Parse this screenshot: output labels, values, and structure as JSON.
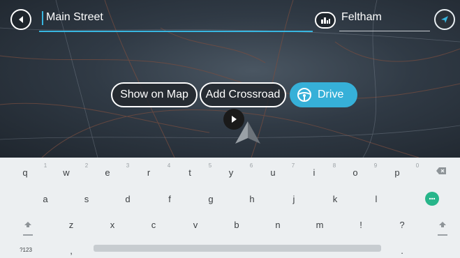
{
  "search": {
    "query": "Main Street"
  },
  "location": {
    "label": "Feltham"
  },
  "actions": {
    "show_on_map": "Show on Map",
    "add_crossroad": "Add Crossroad",
    "drive": "Drive"
  },
  "keyboard": {
    "row1": [
      "q",
      "w",
      "e",
      "r",
      "t",
      "y",
      "u",
      "i",
      "o",
      "p"
    ],
    "row1_hints": [
      "1",
      "2",
      "3",
      "4",
      "5",
      "6",
      "7",
      "8",
      "9",
      "0"
    ],
    "row2": [
      "a",
      "s",
      "d",
      "f",
      "g",
      "h",
      "j",
      "k",
      "l"
    ],
    "row3": [
      "z",
      "x",
      "c",
      "v",
      "b",
      "n",
      "m",
      "!",
      "?"
    ],
    "symbols_label": "?123",
    "comma": ",",
    "period": "."
  },
  "colors": {
    "accent": "#36b0d8",
    "go": "#27b58a",
    "map_bg": "#303a45"
  },
  "icons": {
    "back": "back-arrow-icon",
    "favorite": "poi-icon",
    "navigate": "navigation-arrow-icon",
    "drive": "steering-wheel-icon",
    "backspace": "backspace-icon",
    "go": "go-icon",
    "shift": "shift-icon"
  }
}
